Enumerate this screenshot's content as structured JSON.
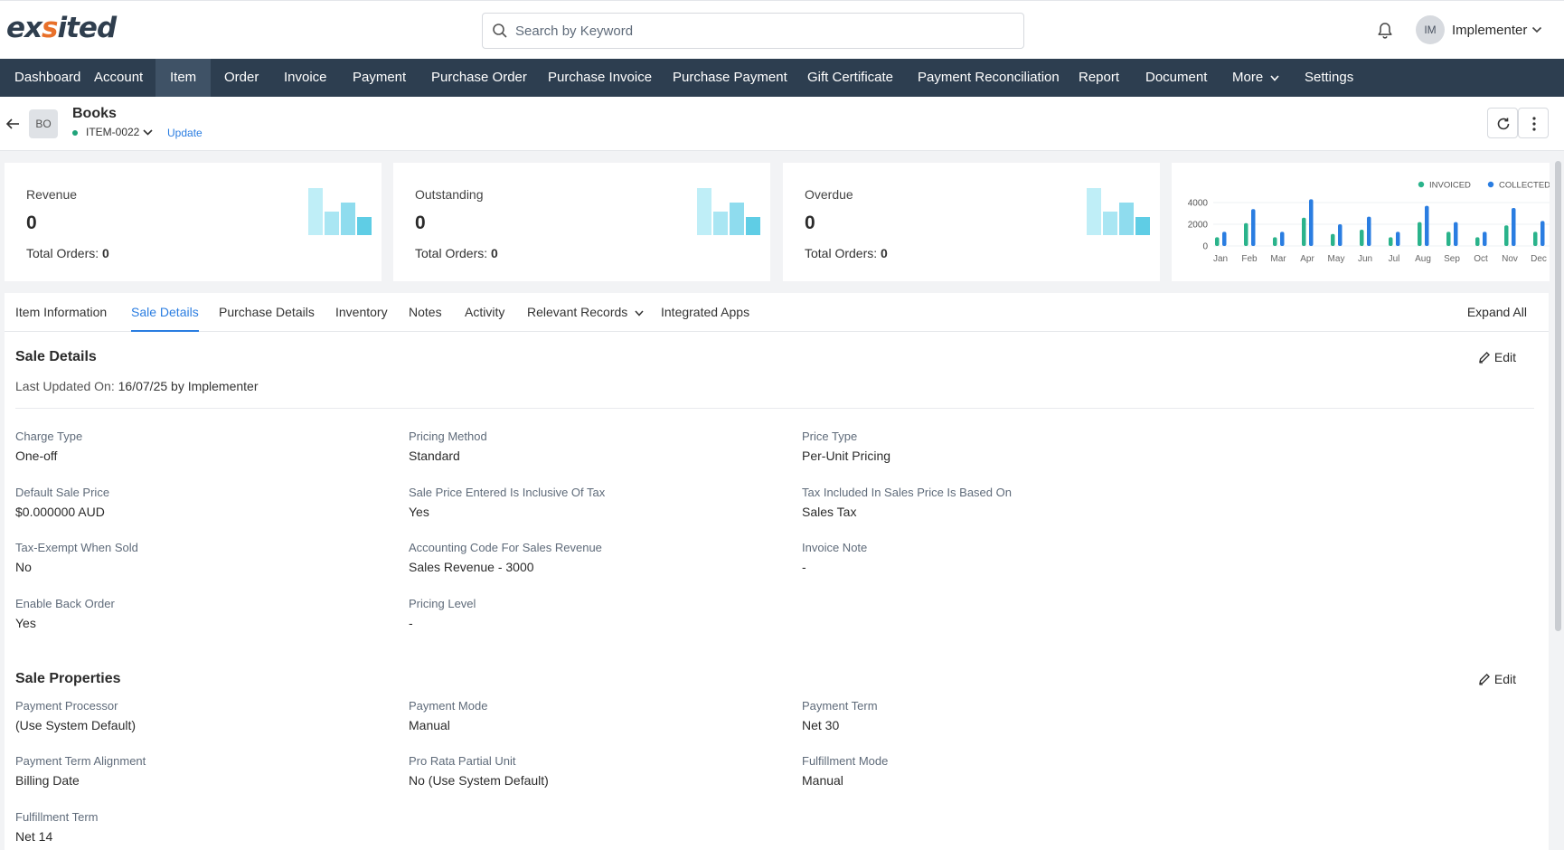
{
  "brand": {
    "logo_pre": "ex",
    "logo_accent": "s",
    "logo_post": "ited",
    "accent_color": "#e8702a",
    "nav_color": "#2d3e50"
  },
  "search": {
    "placeholder": "Search by Keyword",
    "icon": "search-icon"
  },
  "user": {
    "initials": "IM",
    "name": "Implementer"
  },
  "nav": {
    "items": [
      {
        "label": "Dashboard"
      },
      {
        "label": "Account"
      },
      {
        "label": "Item",
        "active": true
      },
      {
        "label": "Order"
      },
      {
        "label": "Invoice"
      },
      {
        "label": "Payment"
      },
      {
        "label": "Purchase Order"
      },
      {
        "label": "Purchase Invoice"
      },
      {
        "label": "Purchase Payment"
      },
      {
        "label": "Gift Certificate"
      },
      {
        "label": "Payment Reconciliation"
      },
      {
        "label": "Report"
      },
      {
        "label": "Document"
      },
      {
        "label": "More"
      },
      {
        "label": "Settings"
      }
    ]
  },
  "item": {
    "initials": "BO",
    "name": "Books",
    "code": "ITEM-0022",
    "update_label": "Update",
    "status_color": "#1fa37a"
  },
  "stats": [
    {
      "label": "Revenue",
      "value": "0",
      "orders_label": "Total Orders:",
      "orders_value": "0"
    },
    {
      "label": "Outstanding",
      "value": "0",
      "orders_label": "Total Orders:",
      "orders_value": "0"
    },
    {
      "label": "Overdue",
      "value": "0",
      "orders_label": "Total Orders:",
      "orders_value": "0"
    }
  ],
  "chart_data": {
    "type": "bar",
    "categories": [
      "Jan",
      "Feb",
      "Mar",
      "Apr",
      "May",
      "Jun",
      "Jul",
      "Aug",
      "Sep",
      "Oct",
      "Nov",
      "Dec"
    ],
    "series": [
      {
        "name": "INVOICED",
        "color": "#2ab38b",
        "values": [
          800,
          2100,
          800,
          2600,
          1100,
          1500,
          800,
          2200,
          1300,
          800,
          1900,
          1300
        ]
      },
      {
        "name": "COLLECTED",
        "color": "#2a7de1",
        "values": [
          1300,
          3400,
          1300,
          4300,
          2000,
          2700,
          1300,
          3700,
          2200,
          1300,
          3500,
          2300
        ]
      }
    ],
    "ylim": [
      0,
      4000
    ],
    "yticks": [
      "4000",
      "2000",
      "0"
    ],
    "legend": "top-right"
  },
  "tabs": {
    "items": [
      {
        "label": "Item Information"
      },
      {
        "label": "Sale Details",
        "active": true
      },
      {
        "label": "Purchase Details"
      },
      {
        "label": "Inventory"
      },
      {
        "label": "Notes"
      },
      {
        "label": "Activity"
      },
      {
        "label": "Relevant Records"
      },
      {
        "label": "Integrated Apps"
      }
    ],
    "expand_all": "Expand All"
  },
  "sale_details": {
    "title": "Sale Details",
    "edit_label": "Edit",
    "last_updated_label": "Last Updated On:",
    "last_updated_value": "16/07/25 by Implementer",
    "fields": [
      {
        "label": "Charge Type",
        "value": "One-off"
      },
      {
        "label": "Pricing Method",
        "value": "Standard"
      },
      {
        "label": "Price Type",
        "value": "Per-Unit Pricing"
      },
      {
        "label": "Default Sale Price",
        "value": "$0.000000 AUD"
      },
      {
        "label": "Sale Price Entered Is Inclusive Of Tax",
        "value": "Yes"
      },
      {
        "label": "Tax Included In Sales Price Is Based On",
        "value": "Sales Tax"
      },
      {
        "label": "Tax-Exempt When Sold",
        "value": "No"
      },
      {
        "label": "Accounting Code For Sales Revenue",
        "value": "Sales Revenue - 3000"
      },
      {
        "label": "Invoice Note",
        "value": "-"
      },
      {
        "label": "Enable Back Order",
        "value": "Yes"
      },
      {
        "label": "Pricing Level",
        "value": "-"
      }
    ]
  },
  "sale_properties": {
    "title": "Sale Properties",
    "edit_label": "Edit",
    "fields": [
      {
        "label": "Payment Processor",
        "value": "(Use System Default)"
      },
      {
        "label": "Payment Mode",
        "value": "Manual"
      },
      {
        "label": "Payment Term",
        "value": "Net 30"
      },
      {
        "label": "Payment Term Alignment",
        "value": "Billing Date"
      },
      {
        "label": "Pro Rata Partial Unit",
        "value": "No (Use System Default)"
      },
      {
        "label": "Fulfillment Mode",
        "value": "Manual"
      },
      {
        "label": "Fulfillment Term",
        "value": "Net 14"
      }
    ]
  }
}
